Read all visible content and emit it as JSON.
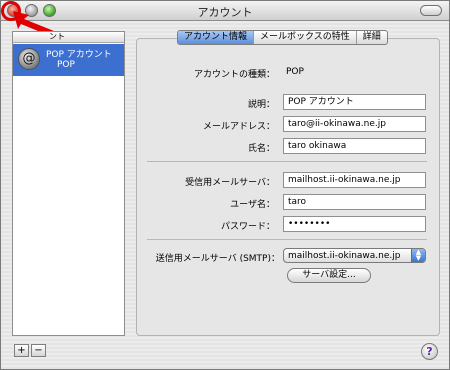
{
  "window": {
    "title": "アカウント"
  },
  "sidebar": {
    "header_label": "ント",
    "accounts": [
      {
        "name": "POP アカウント",
        "type": "POP",
        "icon": "at-sign-icon"
      }
    ],
    "add_label": "+",
    "remove_label": "−"
  },
  "tabs": [
    {
      "label": "アカウント情報",
      "active": true
    },
    {
      "label": "メールボックスの特性",
      "active": false
    },
    {
      "label": "詳細",
      "active": false
    }
  ],
  "form": {
    "account_type_label": "アカウントの種類：",
    "account_type_value": "POP",
    "description_label": "説明：",
    "description_value": "POP アカウント",
    "email_label": "メールアドレス：",
    "email_value": "taro@ii-okinawa.ne.jp",
    "fullname_label": "氏名：",
    "fullname_value": "taro okinawa",
    "incoming_server_label": "受信用メールサーバ：",
    "incoming_server_value": "mailhost.ii-okinawa.ne.jp",
    "username_label": "ユーザ名：",
    "username_value": "taro",
    "password_label": "パスワード：",
    "password_value": "••••••••",
    "smtp_label": "送信用メールサーバ (SMTP)：",
    "smtp_value": "mailhost.ii-okinawa.ne.jp",
    "server_settings_button": "サーバ設定..."
  },
  "help": {
    "label": "?"
  },
  "annotation": {
    "color": "#e00000"
  }
}
